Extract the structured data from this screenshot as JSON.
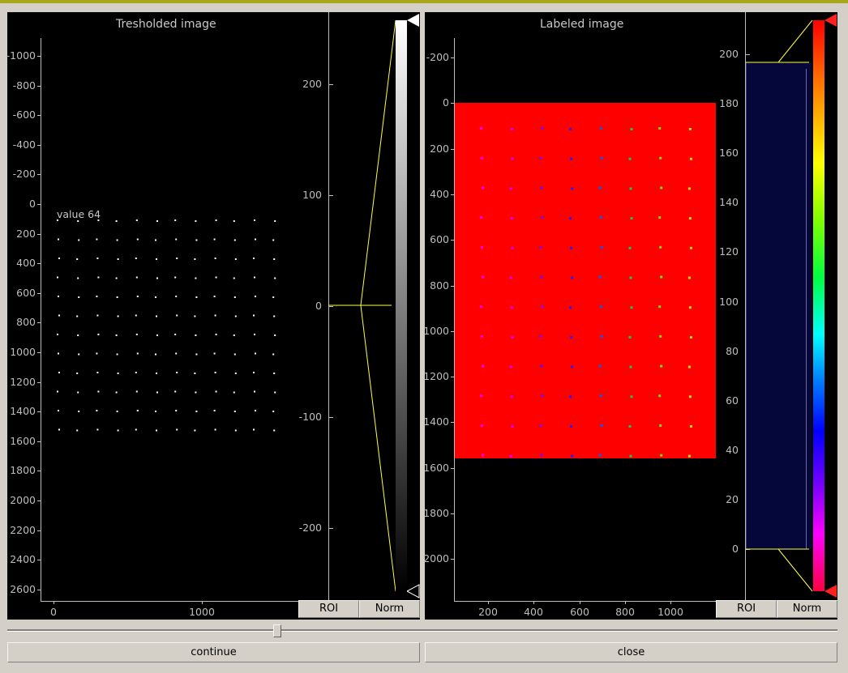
{
  "left": {
    "title": "Tresholded image",
    "value_label": "value 64",
    "y_ticks": [
      "-1000",
      "-800",
      "-600",
      "-400",
      "-200",
      "0",
      "200",
      "400",
      "600",
      "800",
      "1000",
      "1200",
      "1400",
      "1600",
      "1800",
      "2000",
      "2200",
      "2400",
      "2600"
    ],
    "x_ticks": [
      "0",
      "1000"
    ],
    "cbar_ticks": [
      "200",
      "100",
      "0",
      "-100",
      "-200"
    ],
    "colormap": "gray",
    "roi_label": "ROI",
    "norm_label": "Norm"
  },
  "right": {
    "title": "Labeled image",
    "y_ticks": [
      "-200",
      "0",
      "200",
      "400",
      "600",
      "800",
      "1000",
      "1200",
      "1400",
      "1600",
      "1800",
      "2000"
    ],
    "x_ticks": [
      "200",
      "400",
      "600",
      "800",
      "1000"
    ],
    "cbar_ticks": [
      "200",
      "180",
      "160",
      "140",
      "120",
      "100",
      "80",
      "60",
      "40",
      "20",
      "0"
    ],
    "colormap": "rainbow",
    "image_color": "#ff0000",
    "roi_label": "ROI",
    "norm_label": "Norm"
  },
  "slider": {
    "value": 0.325
  },
  "buttons": {
    "continue": "continue",
    "close": "close"
  }
}
